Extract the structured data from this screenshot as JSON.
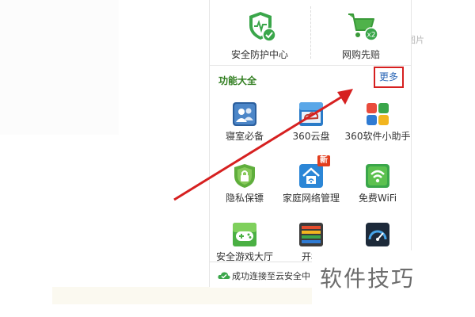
{
  "top_tools": [
    {
      "label": "安全防护中心",
      "icon": "shield-check-icon"
    },
    {
      "label": "网购先赔",
      "icon": "shopping-cart-icon"
    }
  ],
  "section": {
    "title": "功能大全",
    "more_label": "更多"
  },
  "tools": [
    {
      "label": "寝室必备",
      "icon": "dorm-people-icon"
    },
    {
      "label": "360云盘",
      "icon": "cloud-drive-icon"
    },
    {
      "label": "360软件小助手",
      "icon": "software-assistant-icon"
    },
    {
      "label": "隐私保镖",
      "icon": "privacy-lock-icon"
    },
    {
      "label": "家庭网络管理",
      "icon": "home-network-icon",
      "badge": "新"
    },
    {
      "label": "免费WiFi",
      "icon": "wifi-icon"
    },
    {
      "label": "安全游戏大厅",
      "icon": "gamepad-icon"
    },
    {
      "label": "开机",
      "icon": "boot-speed-icon"
    },
    {
      "label": "",
      "icon": "speedometer-icon"
    }
  ],
  "status": {
    "text": "成功连接至云安全中"
  },
  "edge_text": "图片",
  "watermark": "软件技巧",
  "colors": {
    "green": "#2f7d1e",
    "red_annotation": "#d62020",
    "link_blue": "#2a66b6"
  }
}
